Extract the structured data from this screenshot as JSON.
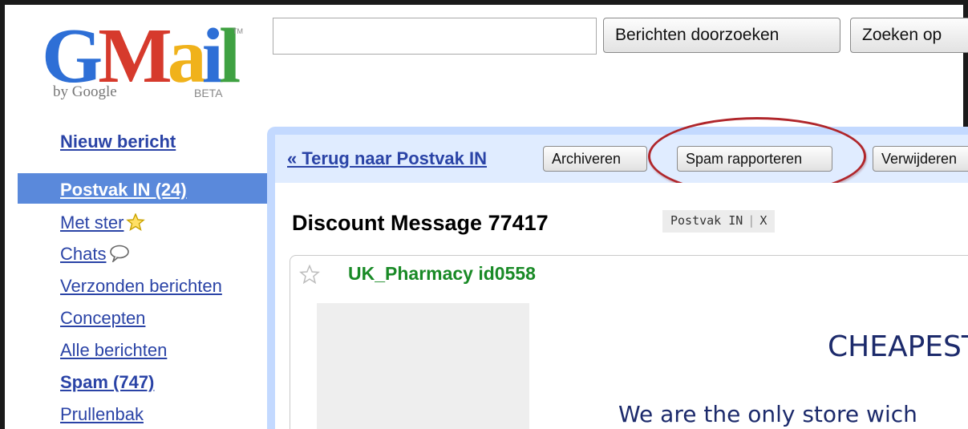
{
  "logo": {
    "g": "G",
    "m": "M",
    "a": "a",
    "i": "i",
    "l": "l",
    "tm": "TM",
    "by": "by Google",
    "beta": "BETA"
  },
  "search": {
    "value": "",
    "search_label": "Berichten doorzoeken",
    "web_label": "Zoeken op"
  },
  "sidebar": {
    "compose": "Nieuw bericht",
    "items": [
      {
        "label": "Postvak IN (24)"
      },
      {
        "label": "Met ster"
      },
      {
        "label": "Chats"
      },
      {
        "label": "Verzonden berichten"
      },
      {
        "label": "Concepten"
      },
      {
        "label": "Alle berichten"
      },
      {
        "label": "Spam (747)"
      },
      {
        "label": "Prullenbak"
      }
    ]
  },
  "toolbar": {
    "back": "« Terug naar Postvak IN",
    "archive": "Archiveren",
    "spam": "Spam rapporteren",
    "delete": "Verwijderen"
  },
  "message": {
    "subject": "Discount Message 77417",
    "label": "Postvak IN",
    "label_remove": "X",
    "sender": "UK_Pharmacy id0558",
    "headline": "CHEAPEST",
    "tagline": "We are the only store wich"
  },
  "colors": {
    "accent": "#5a89db",
    "link": "#2a43a6",
    "highlight": "#b0262b",
    "sender": "#198a26"
  }
}
